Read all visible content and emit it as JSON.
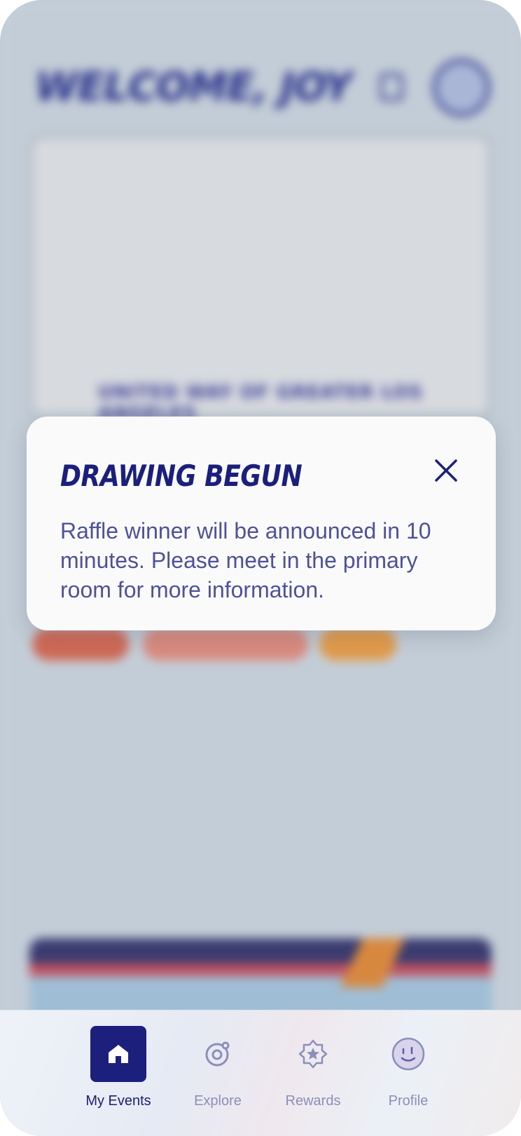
{
  "background": {
    "greeting": "WELCOME, JOY",
    "card_label": "UNITED WAY OF GREATER LOS ANGELES",
    "chips": [
      "",
      "",
      ""
    ],
    "note": ""
  },
  "modal": {
    "title": "DRAWING BEGUN",
    "body": "Raffle winner will be announced in 10 minutes. Please meet in the primary room for more information."
  },
  "tabbar": {
    "tabs": [
      {
        "label": "My Events",
        "icon": "home-icon",
        "active": true
      },
      {
        "label": "Explore",
        "icon": "explore-icon",
        "active": false
      },
      {
        "label": "Rewards",
        "icon": "rewards-star-icon",
        "active": false
      },
      {
        "label": "Profile",
        "icon": "profile-face-icon",
        "active": false
      }
    ]
  },
  "colors": {
    "brand_navy": "#1c207c",
    "body_text": "#4d5299",
    "inactive_tab": "#8a8fba"
  }
}
